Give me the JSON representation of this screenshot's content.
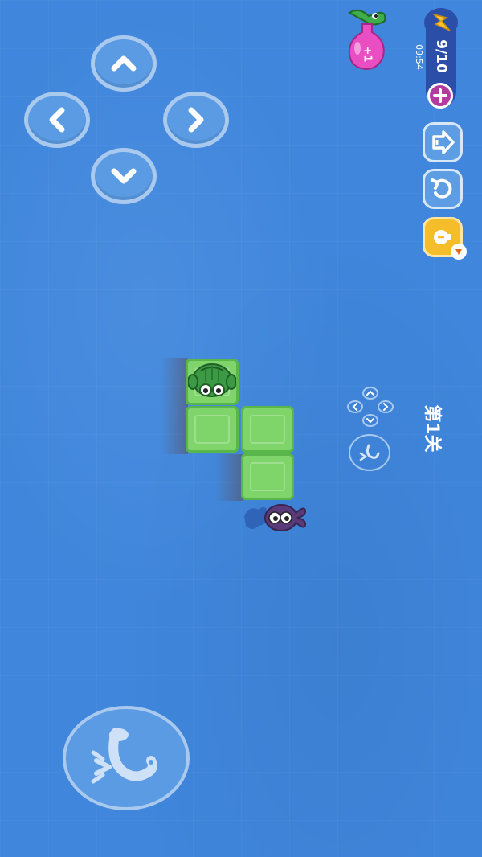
{
  "hud": {
    "energy": "9/10",
    "clock": "09:54",
    "level": "第1关",
    "bonus_badge": "+1",
    "colors": {
      "background": "#3f86dc",
      "button": "#5b9be3",
      "hint": "#f6bd2a",
      "energy_pill": "#2b4fa8",
      "plus": "#b43aa0",
      "tile": "#7fd46a"
    }
  },
  "controls": {
    "dpad": [
      "chevron-up-icon",
      "chevron-left-icon",
      "chevron-right-icon",
      "chevron-down-icon"
    ],
    "side_buttons": [
      "exit-icon",
      "undo-icon",
      "hint-bulb-icon"
    ],
    "big_button": "tongue-action-icon"
  }
}
